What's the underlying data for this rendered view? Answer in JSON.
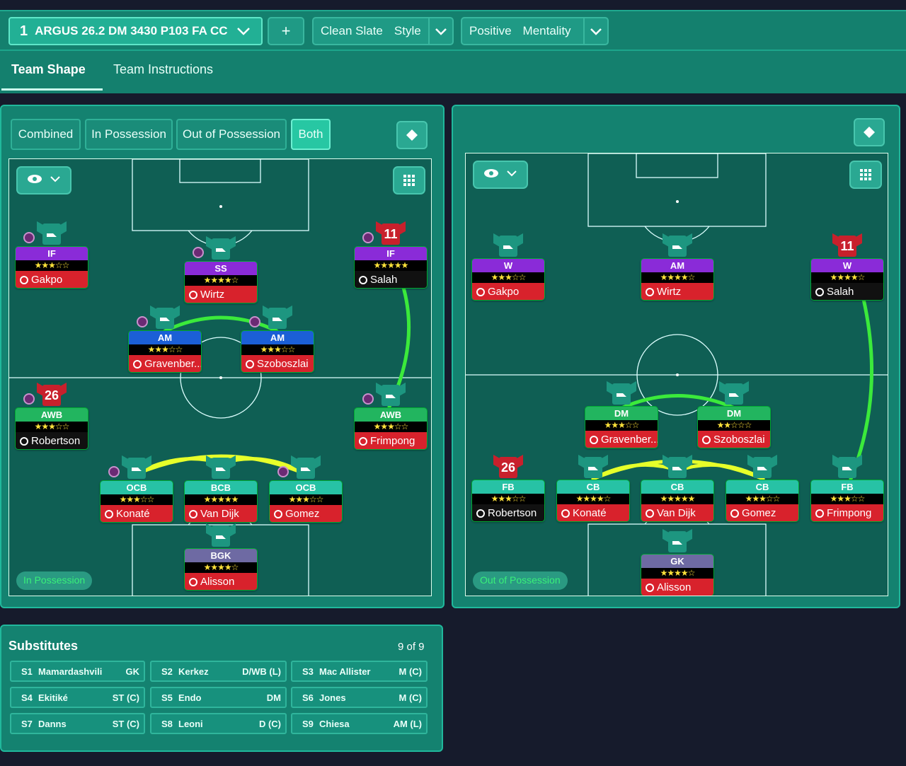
{
  "header": {
    "tactic_number": "1",
    "tactic_name": "ARGUS 26.2 DM 3430 P103 FA CC",
    "add_label": "+",
    "style_name": "Clean Slate",
    "style_label": "Style",
    "mentality_name": "Positive",
    "mentality_label": "Mentality"
  },
  "tabs": [
    {
      "label": "Team Shape"
    },
    {
      "label": "Team Instructions"
    }
  ],
  "view_buttons": [
    "Combined",
    "In Possession",
    "Out of Possession",
    "Both"
  ],
  "colors": {
    "accent": "#22b095",
    "panel": "#148270",
    "pitch": "#0f5f54",
    "link": "#3bea3b",
    "link_alt": "#e6ff2a"
  },
  "left_pitch": {
    "phase_label": "In Possession",
    "players": [
      {
        "role": "IF",
        "stars": "★★★☆☆",
        "name": "Gakpo",
        "role_color": "purple",
        "name_color": "red"
      },
      {
        "role": "SS",
        "stars": "★★★★☆",
        "name": "Wirtz",
        "role_color": "purple",
        "name_color": "red"
      },
      {
        "role": "IF",
        "stars": "★★★★★",
        "name": "Salah",
        "role_color": "purple",
        "name_color": "black",
        "kit": "11"
      },
      {
        "role": "AM",
        "stars": "★★★☆☆",
        "name": "Gravenber...",
        "role_color": "blue",
        "name_color": "red"
      },
      {
        "role": "AM",
        "stars": "★★★☆☆",
        "name": "Szoboszlai",
        "role_color": "blue",
        "name_color": "red"
      },
      {
        "role": "AWB",
        "stars": "★★★☆☆",
        "name": "Robertson",
        "role_color": "green",
        "name_color": "black",
        "kit": "26"
      },
      {
        "role": "AWB",
        "stars": "★★★☆☆",
        "name": "Frimpong",
        "role_color": "green",
        "name_color": "red"
      },
      {
        "role": "OCB",
        "stars": "★★★☆☆",
        "name": "Konaté",
        "role_color": "teal",
        "name_color": "red"
      },
      {
        "role": "BCB",
        "stars": "★★★★★",
        "name": "Van Dijk",
        "role_color": "teal",
        "name_color": "red"
      },
      {
        "role": "OCB",
        "stars": "★★★☆☆",
        "name": "Gomez",
        "role_color": "teal",
        "name_color": "red"
      },
      {
        "role": "BGK",
        "stars": "★★★★☆",
        "name": "Alisson",
        "role_color": "gk",
        "name_color": "red"
      }
    ]
  },
  "right_pitch": {
    "phase_label": "Out of Possession",
    "players": [
      {
        "role": "W",
        "stars": "★★★☆☆",
        "name": "Gakpo",
        "role_color": "purple",
        "name_color": "red"
      },
      {
        "role": "AM",
        "stars": "★★★★☆",
        "name": "Wirtz",
        "role_color": "purple",
        "name_color": "red"
      },
      {
        "role": "W",
        "stars": "★★★★☆",
        "name": "Salah",
        "role_color": "purple",
        "name_color": "black",
        "kit": "11"
      },
      {
        "role": "DM",
        "stars": "★★★☆☆",
        "name": "Gravenber...",
        "role_color": "green",
        "name_color": "red"
      },
      {
        "role": "DM",
        "stars": "★★☆☆☆",
        "name": "Szoboszlai",
        "role_color": "green",
        "name_color": "red"
      },
      {
        "role": "FB",
        "stars": "★★★☆☆",
        "name": "Robertson",
        "role_color": "teal",
        "name_color": "black",
        "kit": "26"
      },
      {
        "role": "CB",
        "stars": "★★★★☆",
        "name": "Konaté",
        "role_color": "teal",
        "name_color": "red"
      },
      {
        "role": "CB",
        "stars": "★★★★★",
        "name": "Van Dijk",
        "role_color": "teal",
        "name_color": "red"
      },
      {
        "role": "CB",
        "stars": "★★★☆☆",
        "name": "Gomez",
        "role_color": "teal",
        "name_color": "red"
      },
      {
        "role": "FB",
        "stars": "★★★☆☆",
        "name": "Frimpong",
        "role_color": "teal",
        "name_color": "red"
      },
      {
        "role": "GK",
        "stars": "★★★★☆",
        "name": "Alisson",
        "role_color": "gk",
        "name_color": "red"
      }
    ]
  },
  "substitutes": {
    "title": "Substitutes",
    "count": "9 of 9",
    "rows": [
      {
        "id": "S1",
        "name": "Mamardashvili",
        "pos": "GK"
      },
      {
        "id": "S2",
        "name": "Kerkez",
        "pos": "D/WB (L)"
      },
      {
        "id": "S3",
        "name": "Mac Allister",
        "pos": "M (C)"
      },
      {
        "id": "S4",
        "name": "Ekitiké",
        "pos": "ST (C)"
      },
      {
        "id": "S5",
        "name": "Endo",
        "pos": "DM"
      },
      {
        "id": "S6",
        "name": "Jones",
        "pos": "M (C)"
      },
      {
        "id": "S7",
        "name": "Danns",
        "pos": "ST (C)"
      },
      {
        "id": "S8",
        "name": "Leoni",
        "pos": "D (C)"
      },
      {
        "id": "S9",
        "name": "Chiesa",
        "pos": "AM (L)"
      }
    ]
  }
}
